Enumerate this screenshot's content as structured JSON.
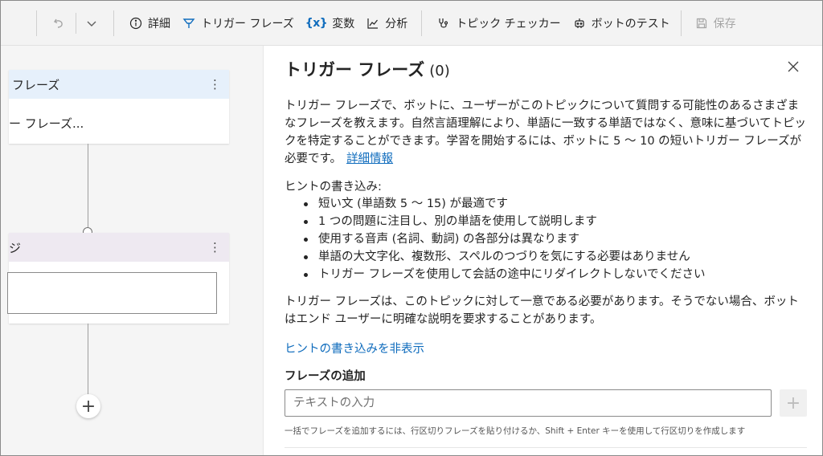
{
  "toolbar": {
    "undo_icon": "undo-icon",
    "dropdown_icon": "chevron-down-icon",
    "details_label": "詳細",
    "trigger_label": "トリガー フレーズ",
    "variables_icon_text": "{x}",
    "variables_label": "変数",
    "analytics_label": "分析",
    "topic_checker_label": "トピック チェッカー",
    "test_bot_label": "ボットのテスト",
    "save_label": "保存"
  },
  "canvas": {
    "trigger_node_title": "フレーズ",
    "trigger_node_summary": "ー フレーズ...",
    "message_node_title": "ジ",
    "node_menu": "⋮",
    "add_node": "+"
  },
  "panel": {
    "title": "トリガー フレーズ",
    "count": "(0)",
    "description": "トリガー フレーズで、ボットに、ユーザーがこのトピックについて質問する可能性のあるさまざまなフレーズを教えます。自然言語理解により、単語に一致する単語ではなく、意味に基づいてトピックを特定することができます。学習を開始するには、ボットに 5 ～ 10 の短いトリガー フレーズが必要です。",
    "learn_more": "詳細情報",
    "hints_title": "ヒントの書き込み:",
    "hints": [
      "短い文 (単語数 5 ～ 15) が最適です",
      "1 つの問題に注目し、別の単語を使用して説明します",
      "使用する音声 (名詞、動詞) の各部分は異なります",
      "単語の大文字化、複数形、スペルのつづりを気にする必要はありません",
      "トリガー フレーズを使用して会話の途中にリダイレクトしないでください"
    ],
    "unique_note": "トリガー フレーズは、このトピックに対して一意である必要があります。そうでない場合、ボットはエンド ユーザーに明確な説明を要求することがあります。",
    "hide_hints": "ヒントの書き込みを非表示",
    "add_phrases_label": "フレーズの追加",
    "input_placeholder": "テキストの入力",
    "input_value": "",
    "add_button": "+",
    "help_text": "一括でフレーズを追加するには、行区切りフレーズを貼り付けるか、Shift + Enter キーを使用して行区切りを作成します"
  }
}
